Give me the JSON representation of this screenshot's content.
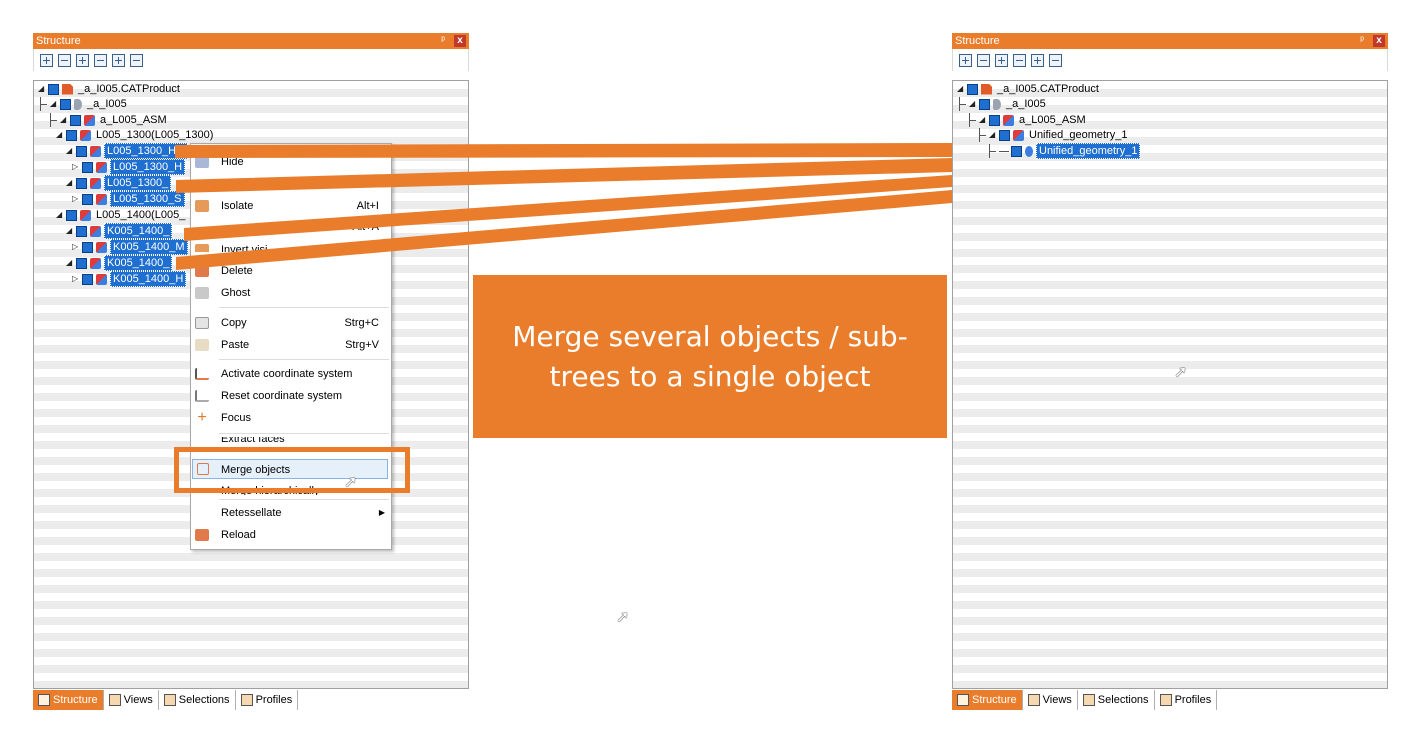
{
  "left_panel": {
    "title": "Structure",
    "pin": "ᵖ",
    "close": "x",
    "tree": [
      {
        "label": "_a_I005.CATProduct"
      },
      {
        "label": "_a_I005"
      },
      {
        "label": "a_L005_ASM"
      },
      {
        "label": "L005_1300(L005_1300)"
      },
      {
        "label": "L005_1300_H..."
      },
      {
        "label": "L005_1300_H"
      },
      {
        "label": "L005_1300_"
      },
      {
        "label": "L005_1300_S"
      },
      {
        "label": "L005_1400(L005_"
      },
      {
        "label": "K005_1400_"
      },
      {
        "label": "K005_1400_M"
      },
      {
        "label": "K005_1400_"
      },
      {
        "label": "K005_1400_H"
      }
    ]
  },
  "right_panel": {
    "title": "Structure",
    "pin": "ᵖ",
    "close": "x",
    "tree": [
      {
        "label": "_a_I005.CATProduct"
      },
      {
        "label": "_a_I005"
      },
      {
        "label": "a_L005_ASM"
      },
      {
        "label": "Unified_geometry_1"
      },
      {
        "label": "Unified_geometry_1"
      }
    ]
  },
  "tabs": [
    {
      "label": "Structure"
    },
    {
      "label": "Views"
    },
    {
      "label": "Selections"
    },
    {
      "label": "Profiles"
    }
  ],
  "context_menu": {
    "hide": "Hide",
    "isolate": "Isolate",
    "isolate_shortcut": "Alt+I",
    "show_all_shortcut": "Alt+A",
    "invert": "Invert visi...",
    "delete": "Delete",
    "ghost": "Ghost",
    "copy": "Copy",
    "copy_shortcut": "Strg+C",
    "paste": "Paste",
    "paste_shortcut": "Strg+V",
    "activate_cs": "Activate coordinate system",
    "reset_cs": "Reset coordinate system",
    "focus": "Focus",
    "extract_faces": "Extract faces",
    "merge_objects": "Merge objects",
    "merge_hier": "Merge hierarchically",
    "retessellate": "Retessellate",
    "reload": "Reload"
  },
  "callout": {
    "text": "Merge several objects / sub-trees to a single object"
  },
  "colors": {
    "accent": "#ea7d2c",
    "selection": "#1e6fd0"
  }
}
